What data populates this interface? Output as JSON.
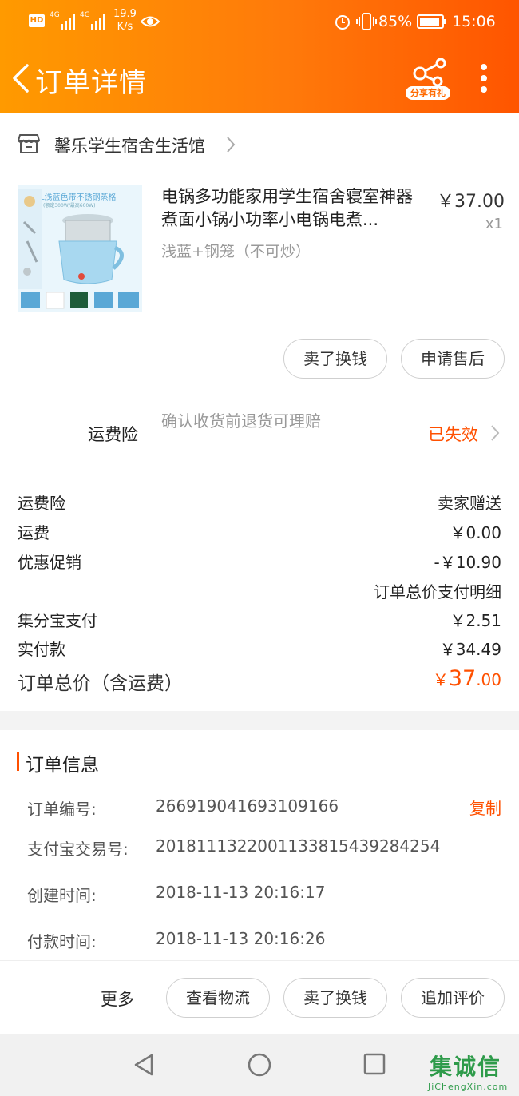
{
  "status_bar": {
    "net1": "4G",
    "net2": "4G",
    "speed_value": "19.9",
    "speed_unit": "K/s",
    "battery": "85%",
    "time": "15:06",
    "hd_label": "HD"
  },
  "header": {
    "title": "订单详情",
    "share_label": "分享有礼"
  },
  "shop": {
    "name": "馨乐学生宿舍生活馆"
  },
  "product": {
    "name": "电锅多功能家用学生宿舍寝室神器煮面小锅小功率小电锅电煮...",
    "price": "￥37.00",
    "quantity": "x1",
    "spec": "浅蓝+钢笼（不可炒）",
    "image_caption": "1.8L浅蓝色带不锈钢蒸格",
    "image_caption2": "(额定300W/最高600W)"
  },
  "product_actions": {
    "sell_label": "卖了换钱",
    "aftersale_label": "申请售后"
  },
  "insurance": {
    "label": "运费险",
    "desc": "确认收货前退货可理赔",
    "status": "已失效"
  },
  "costs": [
    {
      "label": "运费险",
      "value": "卖家赠送"
    },
    {
      "label": "运费",
      "value": "￥0.00"
    },
    {
      "label": "优惠促销",
      "value": "-￥10.90"
    },
    {
      "label": "",
      "value": "订单总价支付明细"
    },
    {
      "label": "集分宝支付",
      "value": "￥2.51"
    },
    {
      "label": "实付款",
      "value": "￥34.49"
    }
  ],
  "total": {
    "label": "订单总价（含运费）",
    "currency": "￥",
    "integer": "37",
    "decimal": ".00"
  },
  "order_info": {
    "title": "订单信息",
    "copy_label": "复制",
    "rows": [
      {
        "label": "订单编号:",
        "value": "266919041693109166"
      },
      {
        "label": "支付宝交易号:",
        "value": "2018111322001133815439284254"
      },
      {
        "label": "创建时间:",
        "value": "2018-11-13 20:16:17"
      },
      {
        "label": "付款时间:",
        "value": "2018-11-13 20:16:26"
      }
    ]
  },
  "bottom_bar": {
    "more": "更多",
    "logistics": "查看物流",
    "sell": "卖了换钱",
    "review": "追加评价"
  },
  "watermark": {
    "text": "集诚信",
    "url": "JiChengXin.com"
  },
  "colors": {
    "accent": "#ff5000",
    "header_start": "#ff9a00",
    "header_end": "#ff5500"
  }
}
